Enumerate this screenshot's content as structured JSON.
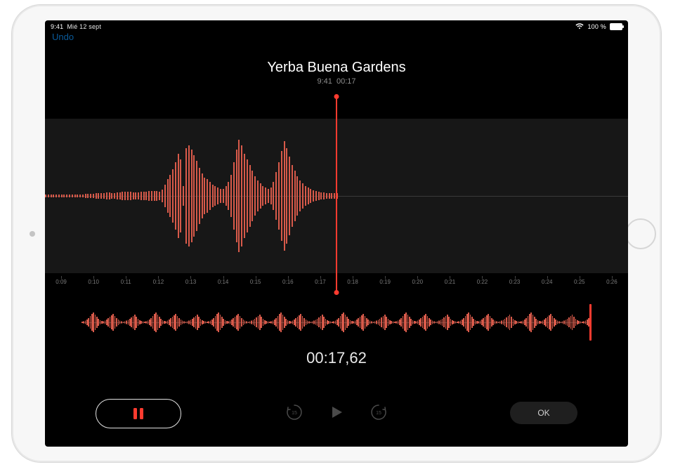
{
  "colors": {
    "accent": "#ff3b2f",
    "wave": "#d85a4a",
    "muted": "#4a4a4a",
    "panel": "#171717"
  },
  "status": {
    "time": "9:41",
    "date": "Mié 12 sept",
    "battery_pct": "100 %"
  },
  "nav": {
    "undo_label": "Undo"
  },
  "recording": {
    "title": "Yerba Buena Gardens",
    "subtitle_time": "9:41",
    "subtitle_duration": "00:17"
  },
  "ruler": {
    "labels": [
      "0:09",
      "0:10",
      "0:11",
      "0:12",
      "0:13",
      "0:14",
      "0:15",
      "0:16",
      "0:17",
      "0:18",
      "0:19",
      "0:20",
      "0:21",
      "0:22",
      "0:23",
      "0:24",
      "0:25",
      "0:26"
    ]
  },
  "timer": {
    "display": "00:17,62"
  },
  "controls": {
    "ok_label": "OK",
    "skip_seconds": "15"
  },
  "wave_main": {
    "count": 220,
    "recorded_until_fraction": 0.5,
    "heights": [
      2,
      2,
      2,
      2,
      2,
      2,
      2,
      2,
      2,
      2,
      2,
      2,
      2,
      2,
      2,
      3,
      3,
      3,
      3,
      4,
      4,
      4,
      4,
      5,
      5,
      4,
      4,
      5,
      5,
      6,
      6,
      6,
      6,
      5,
      5,
      5,
      6,
      6,
      6,
      7,
      7,
      7,
      7,
      6,
      9,
      16,
      24,
      30,
      38,
      48,
      60,
      52,
      14,
      68,
      72,
      66,
      58,
      50,
      40,
      32,
      26,
      24,
      20,
      16,
      14,
      12,
      10,
      10,
      14,
      20,
      30,
      48,
      66,
      80,
      72,
      60,
      52,
      44,
      36,
      28,
      22,
      18,
      14,
      12,
      10,
      12,
      20,
      34,
      48,
      64,
      78,
      68,
      56,
      44,
      36,
      28,
      22,
      18,
      14,
      12,
      10,
      8,
      7,
      6,
      5,
      5,
      4,
      4,
      4,
      4,
      4,
      0,
      0,
      0,
      0,
      0,
      0,
      0,
      0,
      0,
      0,
      0,
      0,
      0,
      0,
      0,
      0,
      0,
      0,
      0,
      0,
      0,
      0,
      0,
      0,
      0,
      0,
      0,
      0,
      0,
      0,
      0,
      0,
      0,
      0,
      0,
      0,
      0,
      0,
      0,
      0,
      0,
      0,
      0,
      0,
      0,
      0,
      0,
      0,
      0,
      0,
      0,
      0,
      0,
      0,
      0,
      0,
      0,
      0,
      0,
      0,
      0,
      0,
      0,
      0,
      0,
      0,
      0,
      0,
      0,
      0,
      0,
      0,
      0,
      0,
      0,
      0,
      0,
      0,
      0,
      0,
      0,
      0,
      0,
      0,
      0,
      0,
      0,
      0,
      0,
      0,
      0,
      0,
      0,
      0,
      0,
      0,
      0,
      0,
      0,
      0,
      0,
      0,
      0,
      0,
      0,
      0,
      0,
      0,
      0
    ]
  },
  "wave_overview": {
    "count": 310,
    "heights_pattern": [
      2,
      3,
      5,
      8,
      12,
      18,
      24,
      28,
      22,
      16,
      10,
      6,
      4,
      3,
      5,
      8,
      12,
      16,
      20,
      24,
      18,
      12,
      8,
      5,
      3,
      2,
      3,
      5,
      7,
      10,
      14,
      18,
      22,
      16,
      10,
      6,
      4,
      3
    ]
  }
}
